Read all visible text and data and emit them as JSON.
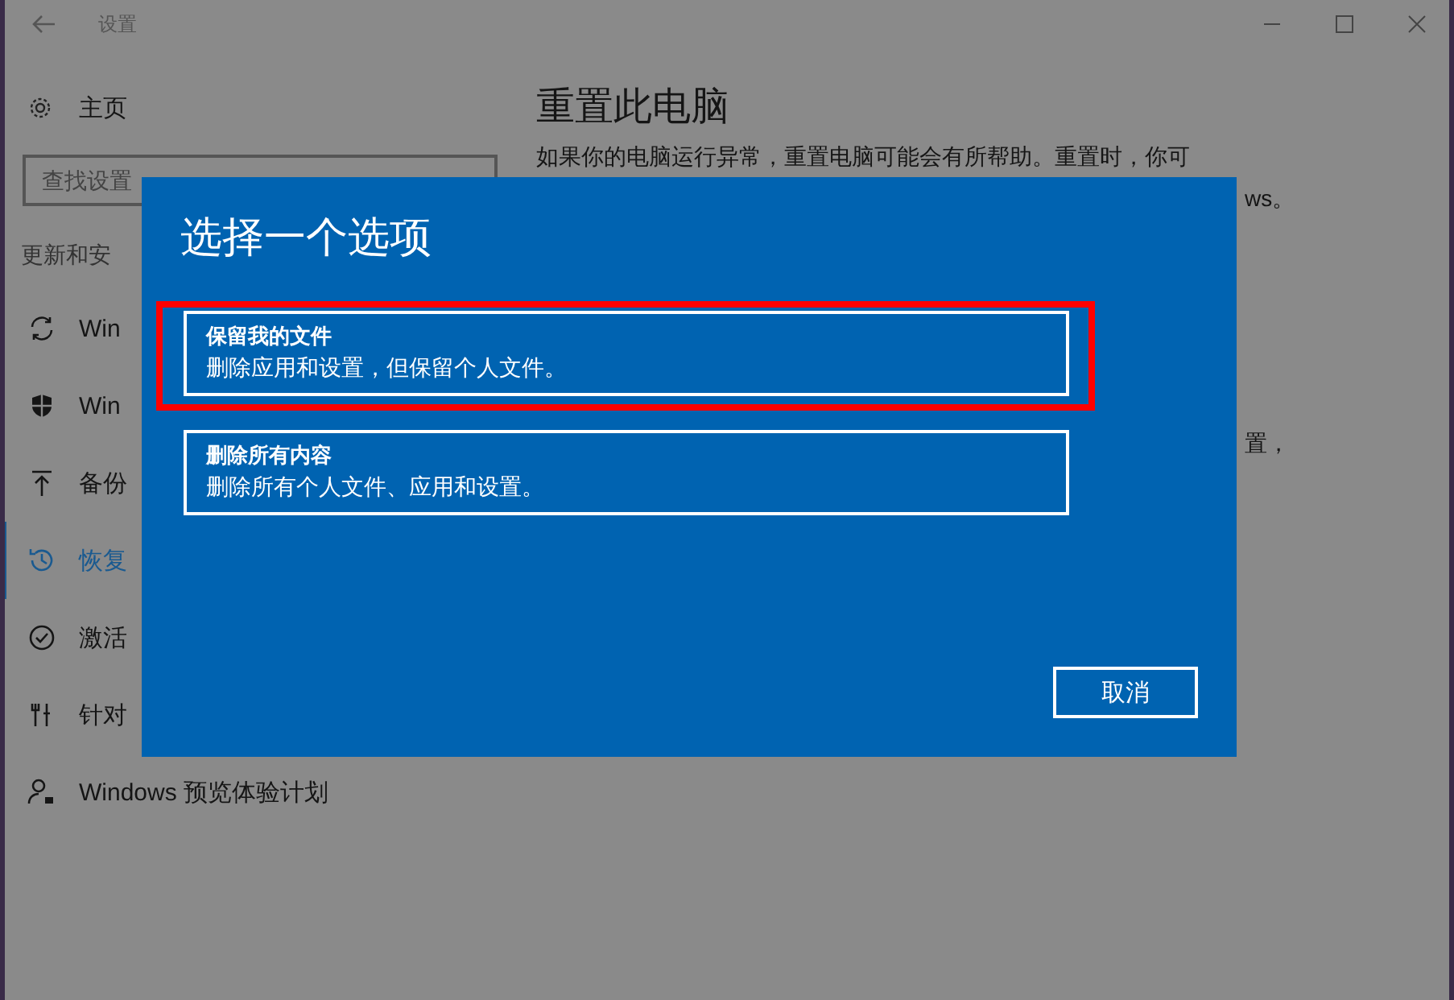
{
  "window": {
    "title": "设置"
  },
  "sidebar": {
    "home": "主页",
    "search": {
      "placeholder": "查找设置"
    },
    "section": "更新和安",
    "items": [
      {
        "label": "Win",
        "selected": false
      },
      {
        "label": "Win",
        "selected": false
      },
      {
        "label": "备份",
        "selected": false
      },
      {
        "label": "恢复",
        "selected": true
      },
      {
        "label": "激活",
        "selected": false
      },
      {
        "label": "针对",
        "selected": false
      },
      {
        "label": "Windows 预览体验计划",
        "selected": false
      }
    ]
  },
  "main": {
    "title": "重置此电脑",
    "lines": [
      "如果你的电脑运行异常，重置电脑可能会有所帮助。重置时，你可",
      "ws。",
      "置，"
    ]
  },
  "dialog": {
    "title": "选择一个选项",
    "options": [
      {
        "title": "保留我的文件",
        "description": "删除应用和设置，但保留个人文件。",
        "highlighted": true
      },
      {
        "title": "删除所有内容",
        "description": "删除所有个人文件、应用和设置。",
        "highlighted": false
      }
    ],
    "cancel": "取消"
  }
}
